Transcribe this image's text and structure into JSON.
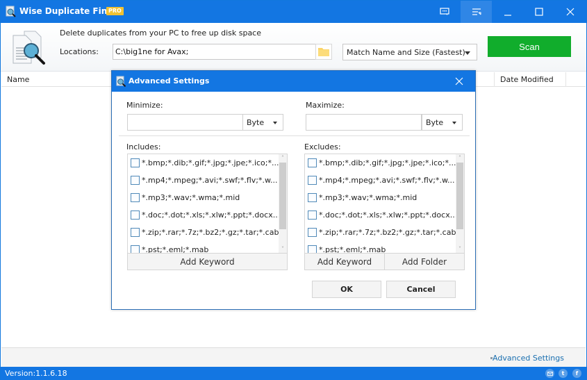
{
  "window": {
    "title": "Wise Duplicate Finder",
    "badge": "PRO",
    "controls": [
      "feedback-icon",
      "menu-icon",
      "minimize-icon",
      "maximize-icon",
      "close-icon"
    ]
  },
  "header": {
    "tagline": "Delete duplicates from your PC to free up disk space",
    "locations_label": "Locations:",
    "locations_value": "C:\\big1ne for Avax;",
    "match_mode": "Match Name and Size (Fastest)",
    "scan_label": "Scan",
    "scan_color": "#11ad2c"
  },
  "columns": {
    "name": "Name",
    "date_modified": "Date Modified"
  },
  "footer": {
    "advanced_link": "Advanced Settings",
    "version": "Version:1.1.6.18",
    "social": [
      "email-icon",
      "twitter-icon",
      "facebook-icon"
    ]
  },
  "dialog": {
    "title": "Advanced Settings",
    "minimize_label": "Minimize:",
    "minimize_value": "",
    "minimize_unit": "Byte",
    "maximize_label": "Maximize:",
    "maximize_value": "",
    "maximize_unit": "Byte",
    "includes_label": "Includes:",
    "excludes_label": "Excludes:",
    "includes": [
      {
        "label": "*.bmp;*.dib;*.gif;*.jpg;*.jpe;*.ico;*...",
        "checked": false
      },
      {
        "label": "*.mp4;*.mpeg;*.avi;*.swf;*.flv;*.w...",
        "checked": false
      },
      {
        "label": "*.mp3;*.wav;*.wma;*.mid",
        "checked": false
      },
      {
        "label": "*.doc;*.dot;*.xls;*.xlw;*.ppt;*.docx...",
        "checked": false
      },
      {
        "label": "*.zip;*.rar;*.7z;*.bz2;*.gz;*.tar;*.cab",
        "checked": false
      },
      {
        "label": "*.pst;*.eml;*.mab",
        "checked": false
      }
    ],
    "excludes": [
      {
        "label": "*.bmp;*.dib;*.gif;*.jpg;*.jpe;*.ico;*...",
        "checked": false
      },
      {
        "label": "*.mp4;*.mpeg;*.avi;*.swf;*.flv;*.w...",
        "checked": false
      },
      {
        "label": "*.mp3;*.wav;*.wma;*.mid",
        "checked": false
      },
      {
        "label": "*.doc;*.dot;*.xls;*.xlw;*.ppt;*.docx...",
        "checked": false
      },
      {
        "label": "*.zip;*.rar;*.7z;*.bz2;*.gz;*.tar;*.cab",
        "checked": false
      },
      {
        "label": "*.pst;*.eml;*.mab",
        "checked": false
      }
    ],
    "add_keyword_label": "Add Keyword",
    "add_folder_label": "Add Folder",
    "ok_label": "OK",
    "cancel_label": "Cancel"
  }
}
